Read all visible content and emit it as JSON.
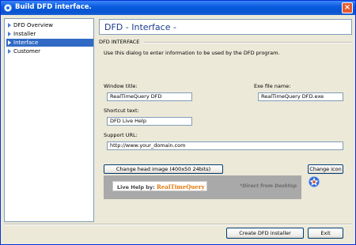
{
  "window": {
    "title": "Build DFD interface."
  },
  "tree": {
    "items": [
      {
        "label": "DFD Overview"
      },
      {
        "label": "Installer"
      },
      {
        "label": "Interface",
        "selected": true
      },
      {
        "label": "Customer"
      }
    ]
  },
  "header": {
    "title": "DFD - Interface -"
  },
  "section": {
    "label": "DFD INTERFACE",
    "description": "Use this dialog to enter information to be used by the DFD program."
  },
  "form": {
    "window_title_label": "Window title:",
    "window_title_value": "RealTimeQuery DFD",
    "exe_label": "Exe file name:",
    "exe_value": "RealTimeQuery DFD.exe",
    "shortcut_label": "Shortcut text:",
    "shortcut_value": "DFD Live Help",
    "support_label": "Support URL:",
    "support_value": "http://www.your_domain.com"
  },
  "buttons": {
    "change_head_image": "Change head image (400x50 24bits)",
    "change_icon": "Change icon",
    "create_installer": "Create DFD installer",
    "exit": "Exit"
  },
  "banner": {
    "live_help": "Live Help by:",
    "brand": "RealTimeQuery",
    "note": "*Direct from Desktop"
  },
  "colors": {
    "selection": "#316ac5",
    "titlebar": "#0a5ce0",
    "brand": "#e07a10"
  }
}
